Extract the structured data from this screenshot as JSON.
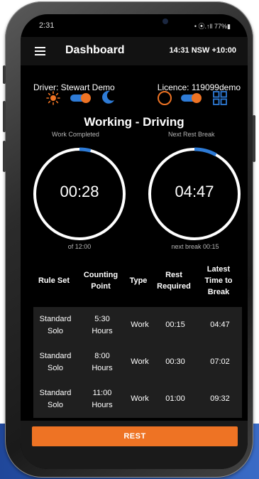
{
  "status_bar": {
    "time": "2:31",
    "indicators": "• ⦿.↑ll 77%▮"
  },
  "app_bar": {
    "menu_icon": "hamburger-menu-icon",
    "title": "Dashboard",
    "time": "14:31 NSW +10:00"
  },
  "info": {
    "driver": "Driver: Stewart Demo",
    "licence": "Licence: 119099demo"
  },
  "toggles": {
    "left": {
      "off_icon": "sun-icon",
      "on_icon": "moon-icon",
      "active": "on"
    },
    "right": {
      "off_icon": "circle-icon",
      "on_icon": "grid-icon",
      "active": "on"
    }
  },
  "status": {
    "title": "Working - Driving"
  },
  "gauges": [
    {
      "label": "Work Completed",
      "value": "00:28",
      "caption": "of 12:00",
      "progress": 0.04
    },
    {
      "label": "Next Rest Break",
      "value": "04:47",
      "caption": "next break 00:15",
      "progress": 0.08
    }
  ],
  "table": {
    "headers": [
      "Rule Set",
      "Counting Point",
      "Type",
      "Rest Required",
      "Latest Time to Break"
    ],
    "rows": [
      [
        "Standard Solo",
        "5:30 Hours",
        "Work",
        "00:15",
        "04:47"
      ],
      [
        "Standard Solo",
        "8:00 Hours",
        "Work",
        "00:30",
        "07:02"
      ],
      [
        "Standard Solo",
        "11:00 Hours",
        "Work",
        "01:00",
        "09:32"
      ]
    ]
  },
  "actions": {
    "rest_label": "REST"
  },
  "colors": {
    "accent": "#EE7324",
    "progress": "#2E7BD6",
    "background": "#000000",
    "table_bg": "#1F1F1F",
    "page_band": "#2A5BB3"
  }
}
